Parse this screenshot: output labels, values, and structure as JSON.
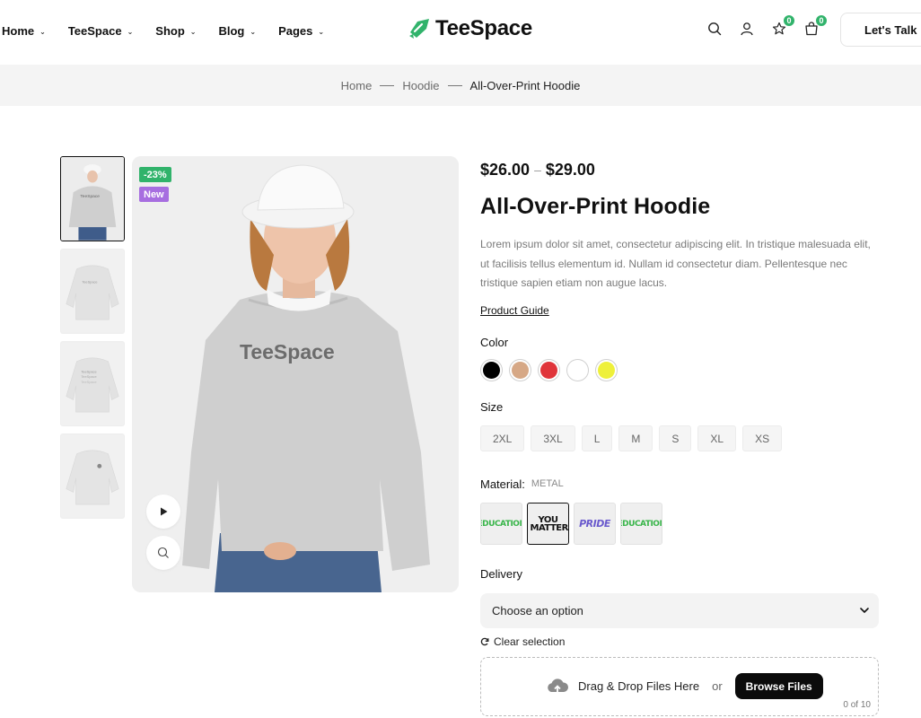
{
  "nav": {
    "items": [
      {
        "label": "Home"
      },
      {
        "label": "TeeSpace"
      },
      {
        "label": "Shop"
      },
      {
        "label": "Blog"
      },
      {
        "label": "Pages"
      }
    ]
  },
  "brand": {
    "name": "TeeSpace",
    "accent": "#31b36b"
  },
  "header": {
    "icons": [
      "search-icon",
      "user-icon",
      "star-icon",
      "bag-icon"
    ],
    "wishlist_count": "0",
    "cart_count": "0",
    "cta_label": "Let's Talk"
  },
  "breadcrumb": [
    "Home",
    "Hoodie",
    "All-Over-Print Hoodie"
  ],
  "gallery": {
    "sale_badge": "-23%",
    "new_badge": "New",
    "shirt_print": "TeeSpace",
    "sale_color": "#31b36b",
    "new_color": "#a76ee0"
  },
  "product": {
    "price_min": "$26.00",
    "price_sep": "–",
    "price_max": "$29.00",
    "title": "All-Over-Print Hoodie",
    "description": "Lorem ipsum dolor sit amet, consectetur adipiscing elit. In tristique malesuada elit, ut facilisis tellus elementum id. Nullam id consectetur diam. Pellentesque nec tristique sapien etiam non augue lacus.",
    "guide_label": "Product Guide",
    "color_label": "Color",
    "colors": [
      "#000000",
      "#d6a886",
      "#e0343a",
      "#ffffff",
      "#eef03a"
    ],
    "size_label": "Size",
    "sizes": [
      "2XL",
      "3XL",
      "L",
      "M",
      "S",
      "XL",
      "XS"
    ],
    "material_label": "Material:",
    "material_value": "METAL",
    "materials": [
      {
        "text": "EDUCATION",
        "color": "#39b54a"
      },
      {
        "text": "YOU MATTER",
        "color": "#111111"
      },
      {
        "text": "PRIDE",
        "color": "#6a5acd"
      },
      {
        "text": "EDUCATION",
        "color": "#39b54a"
      }
    ],
    "delivery_label": "Delivery",
    "delivery_placeholder": "Choose an option",
    "clear_label": "Clear selection",
    "upload": {
      "text": "Drag & Drop Files Here",
      "or": "or",
      "button": "Browse Files",
      "count": "0 of 10"
    }
  }
}
